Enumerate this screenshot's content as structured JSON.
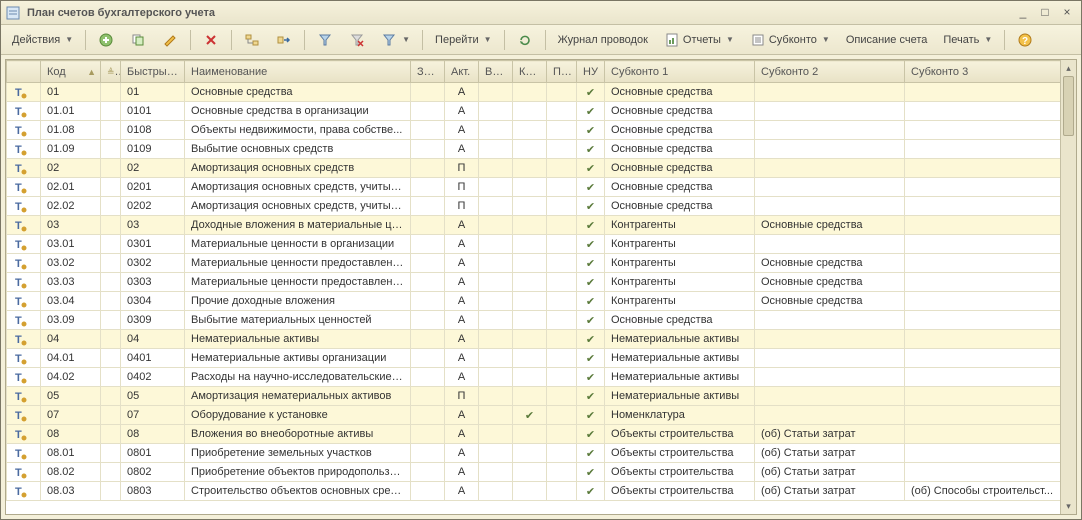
{
  "window": {
    "title": "План счетов бухгалтерского учета"
  },
  "toolbar": {
    "actions": "Действия",
    "goto": "Перейти",
    "journal": "Журнал проводок",
    "reports": "Отчеты",
    "subkonto": "Субконто",
    "descr": "Описание счета",
    "print": "Печать"
  },
  "columns": {
    "code": "Код",
    "quick": "Быстрый...",
    "name": "Наименование",
    "zab": "Заб.",
    "akt": "Акт.",
    "val": "Вал.",
    "kol": "Кол.",
    "po": "По...",
    "nu": "НУ",
    "sub1": "Субконто 1",
    "sub2": "Субконто 2",
    "sub3": "Субконто 3"
  },
  "rows": [
    {
      "hl": 1,
      "code": "01",
      "quick": "01",
      "name": "Основные средства",
      "akt": "А",
      "nu": 1,
      "sub1": "Основные средства"
    },
    {
      "code": "01.01",
      "quick": "0101",
      "name": "Основные средства в организации",
      "akt": "А",
      "nu": 1,
      "sub1": "Основные средства"
    },
    {
      "code": "01.08",
      "quick": "0108",
      "name": "Объекты недвижимости, права собстве...",
      "akt": "А",
      "nu": 1,
      "sub1": "Основные средства"
    },
    {
      "code": "01.09",
      "quick": "0109",
      "name": "Выбытие основных средств",
      "akt": "А",
      "nu": 1,
      "sub1": "Основные средства"
    },
    {
      "hl": 1,
      "code": "02",
      "quick": "02",
      "name": "Амортизация основных средств",
      "akt": "П",
      "nu": 1,
      "sub1": "Основные средства"
    },
    {
      "code": "02.01",
      "quick": "0201",
      "name": "Амортизация основных средств, учитыв...",
      "akt": "П",
      "nu": 1,
      "sub1": "Основные средства"
    },
    {
      "code": "02.02",
      "quick": "0202",
      "name": "Амортизация основных средств, учитыв...",
      "akt": "П",
      "nu": 1,
      "sub1": "Основные средства"
    },
    {
      "hl": 1,
      "code": "03",
      "quick": "03",
      "name": "Доходные вложения в материальные це...",
      "akt": "А",
      "nu": 1,
      "sub1": "Контрагенты",
      "sub2": "Основные средства"
    },
    {
      "code": "03.01",
      "quick": "0301",
      "name": "Материальные ценности в организации",
      "akt": "А",
      "nu": 1,
      "sub1": "Контрагенты"
    },
    {
      "code": "03.02",
      "quick": "0302",
      "name": "Материальные ценности предоставленн...",
      "akt": "А",
      "nu": 1,
      "sub1": "Контрагенты",
      "sub2": "Основные средства"
    },
    {
      "code": "03.03",
      "quick": "0303",
      "name": "Материальные ценности предоставленн...",
      "akt": "А",
      "nu": 1,
      "sub1": "Контрагенты",
      "sub2": "Основные средства"
    },
    {
      "code": "03.04",
      "quick": "0304",
      "name": "Прочие доходные вложения",
      "akt": "А",
      "nu": 1,
      "sub1": "Контрагенты",
      "sub2": "Основные средства"
    },
    {
      "code": "03.09",
      "quick": "0309",
      "name": "Выбытие материальных ценностей",
      "akt": "А",
      "nu": 1,
      "sub1": "Основные средства"
    },
    {
      "hl": 1,
      "code": "04",
      "quick": "04",
      "name": "Нематериальные активы",
      "akt": "А",
      "nu": 1,
      "sub1": "Нематериальные активы"
    },
    {
      "code": "04.01",
      "quick": "0401",
      "name": "Нематериальные активы организации",
      "akt": "А",
      "nu": 1,
      "sub1": "Нематериальные активы"
    },
    {
      "code": "04.02",
      "quick": "0402",
      "name": "Расходы на научно-исследовательские, ...",
      "akt": "А",
      "nu": 1,
      "sub1": "Нематериальные активы"
    },
    {
      "hl": 1,
      "code": "05",
      "quick": "05",
      "name": "Амортизация нематериальных активов",
      "akt": "П",
      "nu": 1,
      "sub1": "Нематериальные активы"
    },
    {
      "hl": 1,
      "code": "07",
      "quick": "07",
      "name": "Оборудование к установке",
      "akt": "А",
      "kol": 1,
      "nu": 1,
      "sub1": "Номенклатура"
    },
    {
      "hl": 1,
      "code": "08",
      "quick": "08",
      "name": "Вложения во внеоборотные активы",
      "akt": "А",
      "nu": 1,
      "sub1": "Объекты строительства",
      "sub2": "(об) Статьи затрат"
    },
    {
      "code": "08.01",
      "quick": "0801",
      "name": "Приобретение земельных участков",
      "akt": "А",
      "nu": 1,
      "sub1": "Объекты строительства",
      "sub2": "(об) Статьи затрат"
    },
    {
      "code": "08.02",
      "quick": "0802",
      "name": "Приобретение объектов природопользо...",
      "akt": "А",
      "nu": 1,
      "sub1": "Объекты строительства",
      "sub2": "(об) Статьи затрат"
    },
    {
      "code": "08.03",
      "quick": "0803",
      "name": "Строительство объектов основных сред...",
      "akt": "А",
      "nu": 1,
      "sub1": "Объекты строительства",
      "sub2": "(об) Статьи затрат",
      "sub3": "(об) Способы строительст..."
    }
  ]
}
